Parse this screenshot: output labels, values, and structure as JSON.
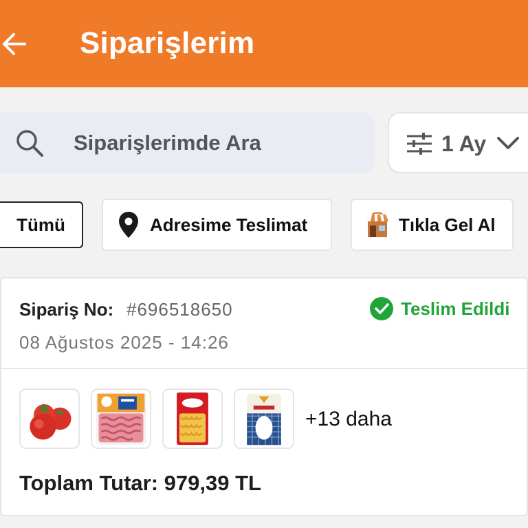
{
  "header": {
    "title": "Siparişlerim",
    "background_color": "#ef7a28"
  },
  "search": {
    "placeholder": "Siparişlerimde Ara"
  },
  "period_filter": {
    "selected": "1 Ay"
  },
  "filters": [
    {
      "label": "Tümü",
      "selected": true
    },
    {
      "label": "Adresime Teslimat",
      "icon": "location-pin-icon"
    },
    {
      "label": "Tıkla Gel Al",
      "icon": "store-icon"
    }
  ],
  "order": {
    "number_label": "Sipariş No:",
    "number": "#696518650",
    "date": "08 Ağustos 2025 - 14:26",
    "status": "Teslim Edildi",
    "status_color": "#21a53a",
    "items": [
      {
        "icon": "tomato-product"
      },
      {
        "icon": "minced-meat-product"
      },
      {
        "icon": "filiz-pasta-product"
      },
      {
        "icon": "rice-product"
      }
    ],
    "more_items": "+13 daha",
    "total": "Toplam Tutar: 979,39 TL"
  }
}
